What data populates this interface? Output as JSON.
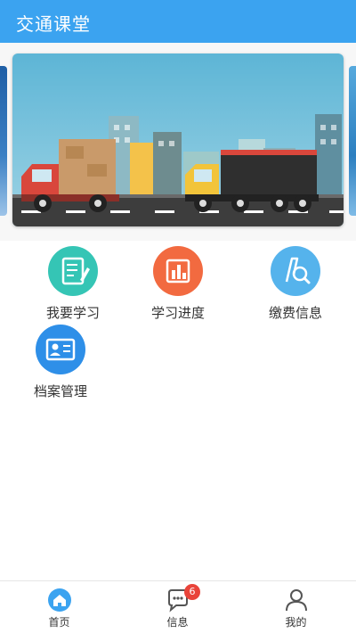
{
  "header": {
    "title": "交通课堂"
  },
  "banner": {
    "illustration": "trucks-city-street"
  },
  "menu": [
    {
      "label": "我要学习",
      "icon": "notebook-pen-icon",
      "color": "#35c5b5"
    },
    {
      "label": "学习进度",
      "icon": "bar-chart-icon",
      "color": "#f26a40"
    },
    {
      "label": "缴费信息",
      "icon": "search-receipt-icon",
      "color": "#55b3ec"
    },
    {
      "label": "档案管理",
      "icon": "id-card-icon",
      "color": "#2e8fe8"
    }
  ],
  "tabbar": {
    "tabs": [
      {
        "label": "首页",
        "icon": "home-icon"
      },
      {
        "label": "信息",
        "icon": "chat-bubble-icon",
        "badge": "6"
      },
      {
        "label": "我的",
        "icon": "user-icon"
      }
    ],
    "active_color": "#3ba3f0"
  }
}
